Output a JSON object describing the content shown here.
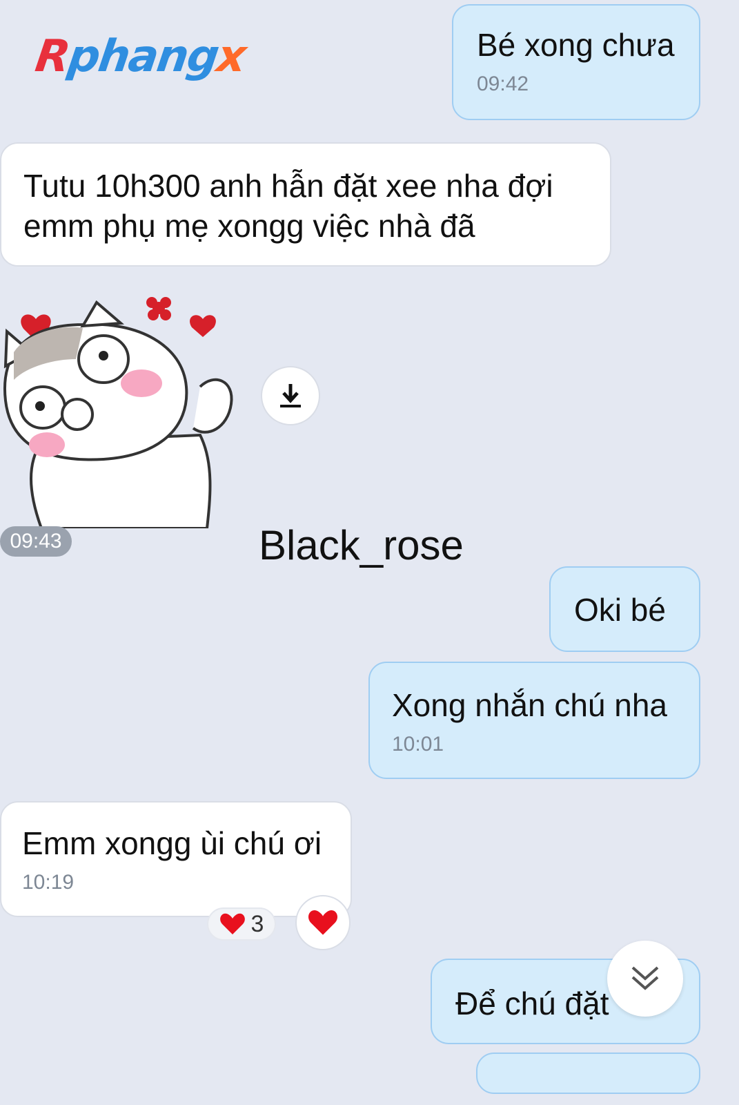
{
  "watermark_logo": {
    "part1": "R",
    "part2": "phang",
    "part3": "x"
  },
  "messages": [
    {
      "text": "Bé xong chưa",
      "time": "09:42"
    },
    {
      "text": "Tutu 10h300 anh hẫn đặt xee nha đợi emm phụ mẹ xongg việc nhà đã"
    },
    {
      "sticker_time": "09:43"
    },
    {
      "text": "Oki bé"
    },
    {
      "text": "Xong nhắn chú nha",
      "time": "10:01"
    },
    {
      "text": "Emm xongg ùi chú ơi",
      "time": "10:19",
      "reaction_count": "3"
    },
    {
      "text": "Để chú đặt"
    }
  ],
  "overlay_text": "Black_rose",
  "icons": {
    "download": "download-icon",
    "heart": "heart-icon",
    "scroll_down": "double-chevron-down-icon"
  },
  "colors": {
    "outgoing_bubble": "#d5ecfb",
    "incoming_bubble": "#ffffff",
    "background": "#e4e8f2"
  }
}
